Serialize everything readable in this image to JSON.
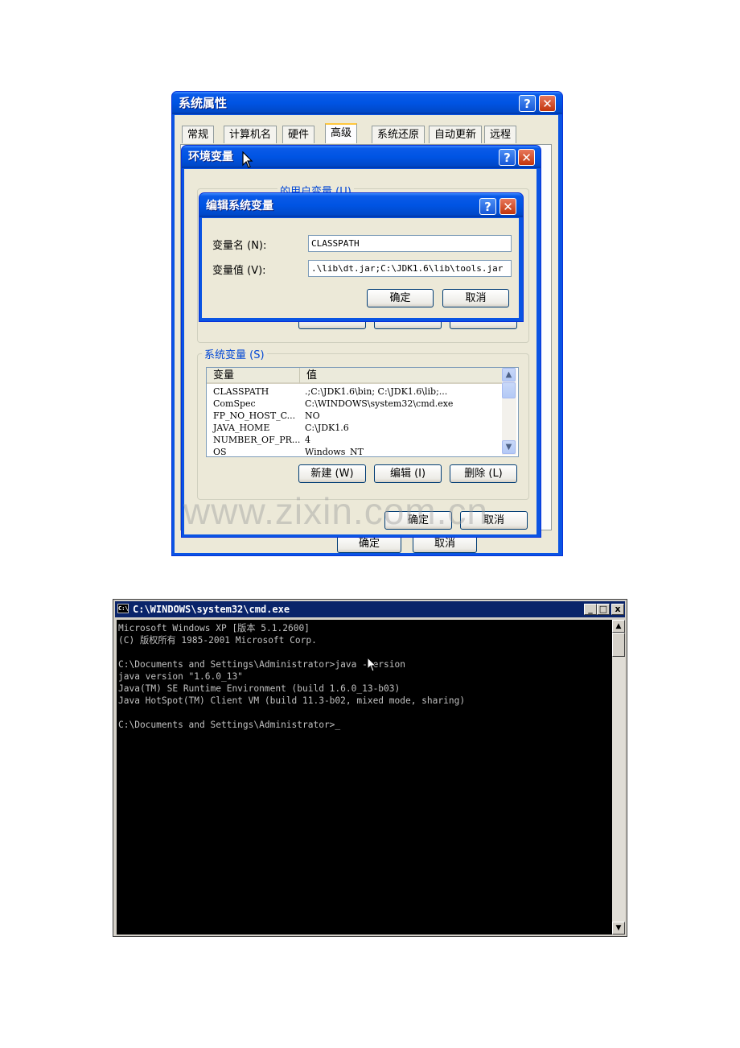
{
  "sysprops": {
    "title": "系统属性",
    "help": "?",
    "close": "✕",
    "tabs": [
      "常规",
      "计算机名",
      "硬件",
      "高级",
      "系统还原",
      "自动更新",
      "远程"
    ],
    "ok": "确定",
    "cancel": "取消"
  },
  "envvars": {
    "title": "环境变量",
    "help": "?",
    "close": "✕",
    "user_group_label": "的用户变量 (U)",
    "system_group_label": "系统变量 (S)",
    "list_headers": [
      "变量",
      "值"
    ],
    "rows": [
      {
        "name": "CLASSPATH",
        "value": ".;C:\\JDK1.6\\bin; C:\\JDK1.6\\lib;..."
      },
      {
        "name": "ComSpec",
        "value": "C:\\WINDOWS\\system32\\cmd.exe"
      },
      {
        "name": "FP_NO_HOST_C...",
        "value": "NO"
      },
      {
        "name": "JAVA_HOME",
        "value": "C:\\JDK1.6"
      },
      {
        "name": "NUMBER_OF_PR...",
        "value": "4"
      },
      {
        "name": "OS",
        "value": "Windows_NT"
      }
    ],
    "new_btn": "新建 (W)",
    "edit_btn": "编辑 (I)",
    "delete_btn": "删除 (L)",
    "ok": "确定",
    "cancel": "取消"
  },
  "editvar": {
    "title": "编辑系统变量",
    "help": "?",
    "close": "✕",
    "name_label": "变量名 (N):",
    "value_label": "变量值 (V):",
    "name_value": "CLASSPATH",
    "value_value": ".\\lib\\dt.jar;C:\\JDK1.6\\lib\\tools.jar",
    "ok": "确定",
    "cancel": "取消"
  },
  "watermark": "www.zixin.com.cn",
  "cmd": {
    "title": "C:\\WINDOWS\\system32\\cmd.exe",
    "icon": "C:\\",
    "minimize": "_",
    "maximize": "□",
    "close": "x",
    "lines": [
      "Microsoft Windows XP [版本 5.1.2600]",
      "(C) 版权所有 1985-2001 Microsoft Corp.",
      "",
      "C:\\Documents and Settings\\Administrator>java -version",
      "java version \"1.6.0_13\"",
      "Java(TM) SE Runtime Environment (build 1.6.0_13-b03)",
      "Java HotSpot(TM) Client VM (build 11.3-b02, mixed mode, sharing)",
      "",
      "C:\\Documents and Settings\\Administrator>_"
    ]
  }
}
